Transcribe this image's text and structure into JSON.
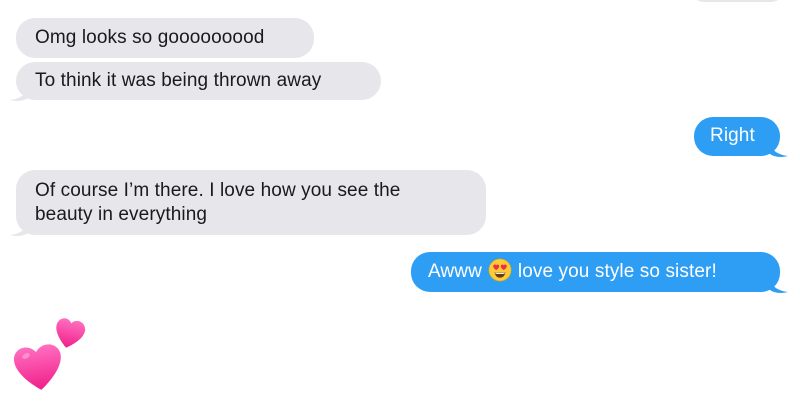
{
  "conversation": {
    "messages": [
      {
        "side": "received",
        "text": "Omg looks so gooooooood"
      },
      {
        "side": "received",
        "text": "To think it was being thrown away"
      },
      {
        "side": "sent",
        "text": "Right"
      },
      {
        "side": "received",
        "line1": "Of course I’m there. I love how you see the",
        "line2": "beauty in everything"
      },
      {
        "side": "sent",
        "before": "Awww",
        "emoji": "smiling-face-with-heart-eyes-icon",
        "after": "love you style so sister!"
      },
      {
        "side": "received",
        "emoji": "two-hearts-icon"
      }
    ]
  },
  "colors": {
    "received_bubble": "#e6e6eb",
    "sent_bubble": "#2e9ef5",
    "received_text": "#1a1a1a",
    "sent_text": "#ffffff",
    "heart": "#ff3f9a"
  }
}
